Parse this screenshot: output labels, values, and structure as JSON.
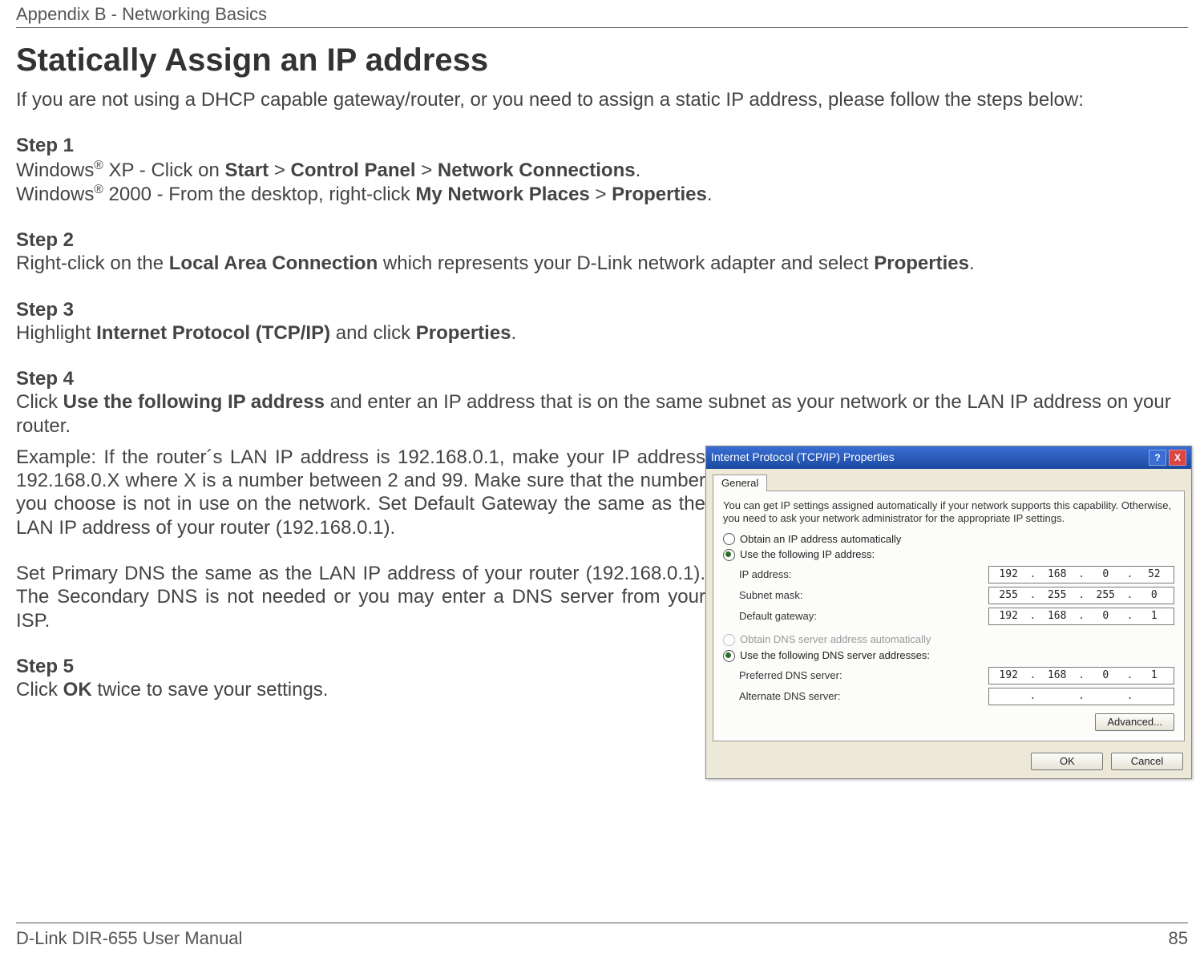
{
  "header": {
    "appendix": "Appendix B - Networking Basics"
  },
  "title": "Statically Assign an IP address",
  "intro": "If you are not using a DHCP capable gateway/router, or you need to assign a static IP address, please follow the steps below:",
  "steps": {
    "s1": {
      "label": "Step 1",
      "xp_pre": "Windows",
      "xp_reg": "®",
      "xp_mid": " XP - Click on ",
      "xp_b1": "Start",
      "xp_gt1": " > ",
      "xp_b2": "Control Panel",
      "xp_gt2": " > ",
      "xp_b3": "Network Connections",
      "xp_dot": ".",
      "w2k_pre": "Windows",
      "w2k_reg": "®",
      "w2k_mid": " 2000 - From the desktop, right-click ",
      "w2k_b1": "My Network Places",
      "w2k_gt": " > ",
      "w2k_b2": "Properties",
      "w2k_dot": "."
    },
    "s2": {
      "label": "Step 2",
      "t1": "Right-click on the ",
      "b1": "Local Area Connection",
      "t2": " which represents your D-Link network adapter and select ",
      "b2": "Properties",
      "dot": "."
    },
    "s3": {
      "label": "Step 3",
      "t1": "Highlight ",
      "b1": "Internet Protocol (TCP/IP)",
      "t2": " and click ",
      "b2": "Properties",
      "dot": "."
    },
    "s4": {
      "label": "Step 4",
      "t1": "Click ",
      "b1": "Use the following IP address",
      "t2": " and enter an IP address that is on the same subnet as your network or the LAN IP address on your router."
    },
    "example": "Example: If the router´s LAN IP address is 192.168.0.1, make your IP address 192.168.0.X where X is a number between 2 and 99. Make sure that the number you choose is not in use on the network. Set Default Gateway the same as the LAN IP address of your router (192.168.0.1).",
    "dns": "Set Primary DNS the same as the LAN IP address of your router (192.168.0.1). The Secondary DNS is not needed or you may enter a DNS server from your ISP.",
    "s5": {
      "label": "Step 5",
      "t1": "Click ",
      "b1": "OK",
      "t2": " twice to save your settings."
    }
  },
  "dialog": {
    "title": "Internet Protocol (TCP/IP) Properties",
    "tab": "General",
    "desc": "You can get IP settings assigned automatically if your network supports this capability. Otherwise, you need to ask your network administrator for the appropriate IP settings.",
    "r1": "Obtain an IP address automatically",
    "r2": "Use the following IP address:",
    "ip_lbl": "IP address:",
    "ip_val": [
      "192",
      "168",
      "0",
      "52"
    ],
    "mask_lbl": "Subnet mask:",
    "mask_val": [
      "255",
      "255",
      "255",
      "0"
    ],
    "gw_lbl": "Default gateway:",
    "gw_val": [
      "192",
      "168",
      "0",
      "1"
    ],
    "r3": "Obtain DNS server address automatically",
    "r4": "Use the following DNS server addresses:",
    "pdns_lbl": "Preferred DNS server:",
    "pdns_val": [
      "192",
      "168",
      "0",
      "1"
    ],
    "adns_lbl": "Alternate DNS server:",
    "adv": "Advanced...",
    "ok": "OK",
    "cancel": "Cancel"
  },
  "footer": {
    "left": "D-Link DIR-655 User Manual",
    "right": "85"
  }
}
